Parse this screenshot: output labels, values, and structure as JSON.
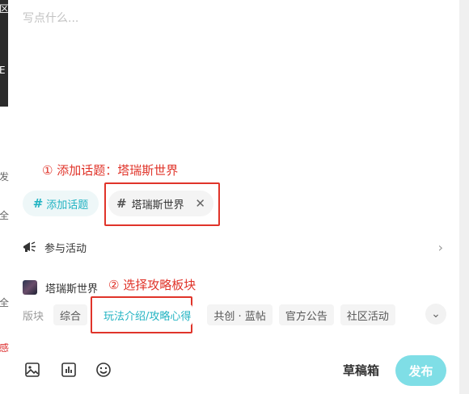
{
  "editor": {
    "placeholder": "写点什么..."
  },
  "annotations": {
    "step1": "① 添加话题：塔瑞斯世界",
    "step2": "② 选择攻略板块"
  },
  "topic": {
    "add_label": "添加话题",
    "hash": "#",
    "selected": "塔瑞斯世界",
    "remove": "✕"
  },
  "activity": {
    "label": "参与活动",
    "chevron": "›"
  },
  "forum": {
    "name": "塔瑞斯世界"
  },
  "section": {
    "label": "版块",
    "tags": [
      "综合",
      "玩法介绍/攻略心得",
      "共创 · 蓝帖",
      "官方公告",
      "社区活动"
    ],
    "expand": "⌄"
  },
  "footer": {
    "draft": "草稿箱",
    "publish": "发布"
  },
  "background_strip": {
    "g1": "区",
    "g2": "E",
    "g3": "发",
    "g4": "全",
    "g5": "全",
    "g6": "感"
  },
  "colors": {
    "accent": "#22b3c2",
    "annotation": "#e0342a",
    "publish_bg": "#7fdee6"
  }
}
